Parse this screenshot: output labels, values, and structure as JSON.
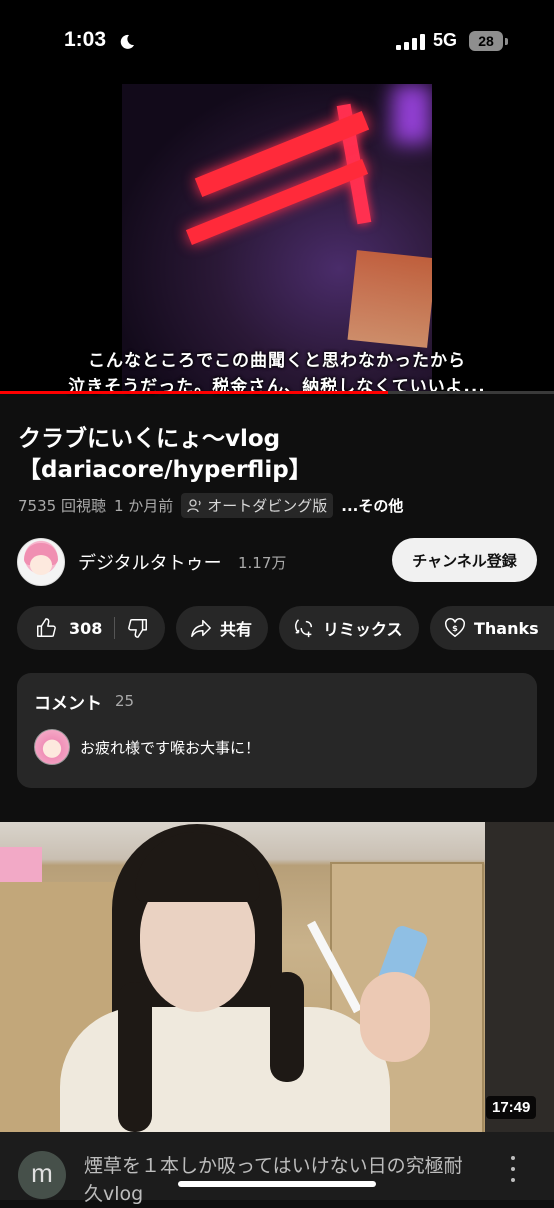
{
  "status_bar": {
    "time": "1:03",
    "network": "5G",
    "battery": "28"
  },
  "player": {
    "subtitle_line1": "こんなところでこの曲聞くと思わなかったから",
    "subtitle_line2": "泣きそうだった。税金さん、納税しなくていいよ...",
    "progress_fraction": 0.7
  },
  "video": {
    "title": "クラブにいくにょ〜vlog【dariacore/hyperflip】",
    "views": "7535 回視聴",
    "age": "1 か月前",
    "dub_label": "オートダビング版",
    "more_label": "...その他"
  },
  "channel": {
    "name": "デジタルタトゥー",
    "subscribers": "1.17万",
    "subscribe_label": "チャンネル登録"
  },
  "actions": {
    "likes": "308",
    "share": "共有",
    "remix": "リミックス",
    "thanks": "Thanks"
  },
  "comments": {
    "title": "コメント",
    "count": "25",
    "top_comment": "お疲れ様です喉お大事に！"
  },
  "next_video": {
    "duration": "17:49",
    "channel_initial": "m",
    "title": "煙草を１本しか吸ってはいけない日の究極耐久vlog"
  },
  "colors": {
    "accent": "#ff0000",
    "background": "#0f0f0f",
    "pill": "#272727"
  }
}
